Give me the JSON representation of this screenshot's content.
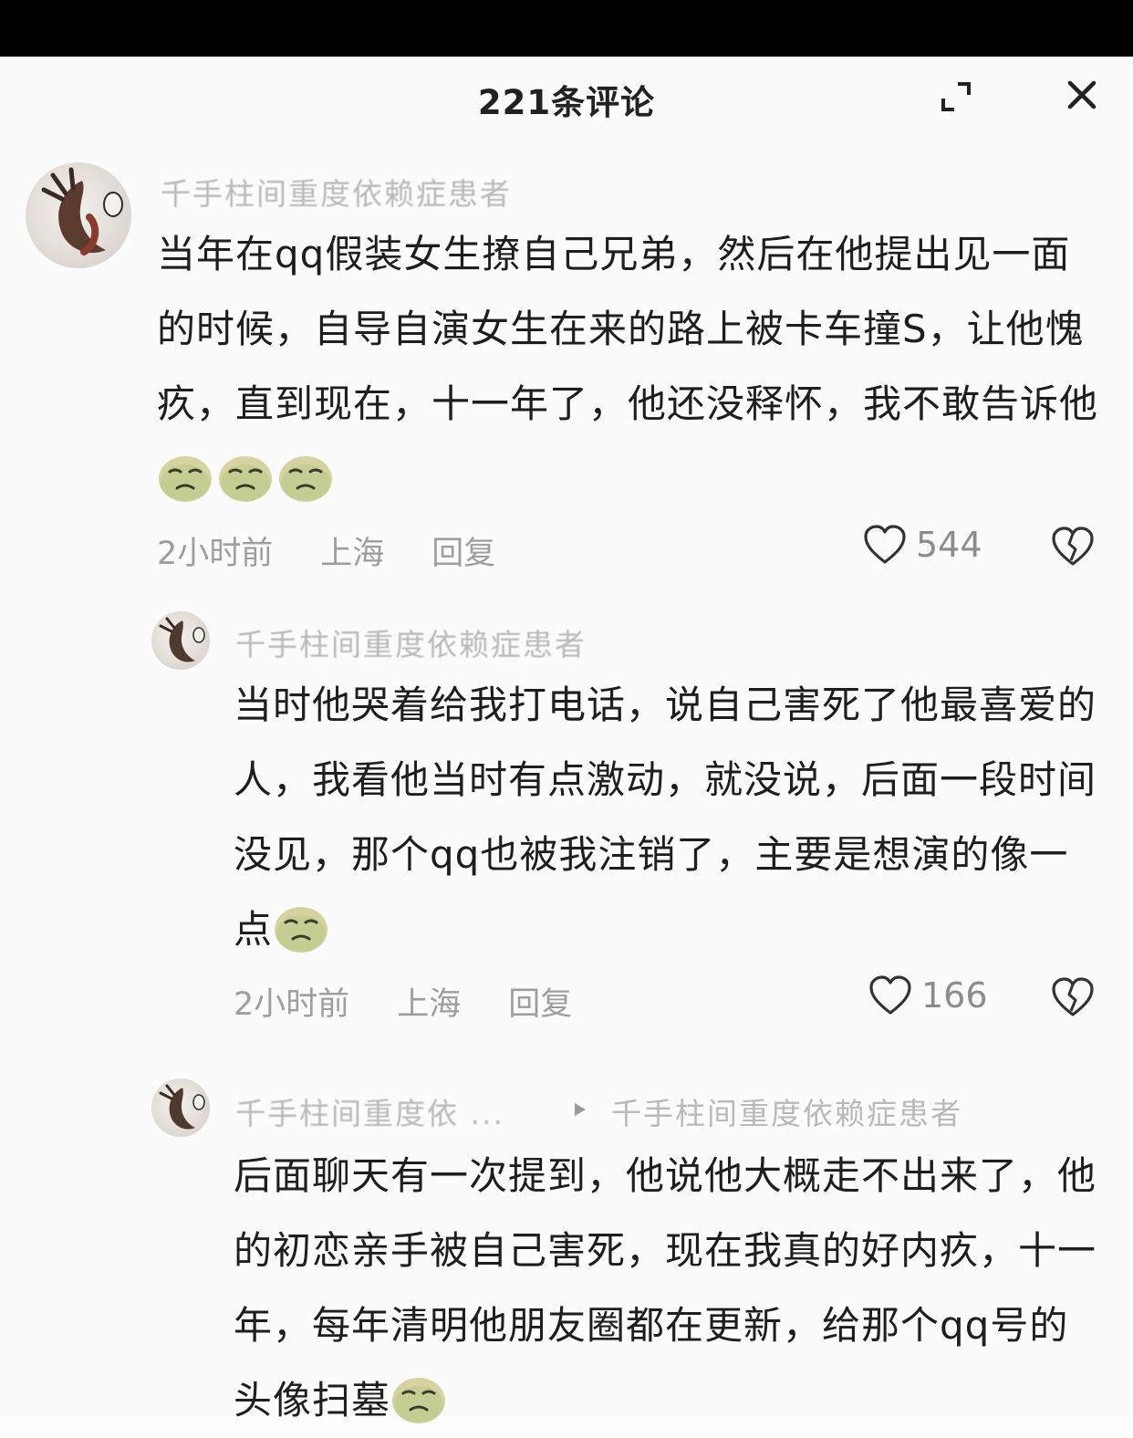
{
  "header": {
    "title": "221条评论",
    "expand_icon": "expand-icon",
    "close_icon": "close-icon"
  },
  "comments": [
    {
      "username": "千手柱间重度依赖症患者",
      "text": "当年在qq假装女生撩自己兄弟，然后在他提出见一面的时候，自导自演女生在来的路上被卡车撞S，让他愧疚，直到现在，十一年了，他还没释怀，我不敢告诉他",
      "emoji_count": 3,
      "time": "2小时前",
      "location": "上海",
      "reply_label": "回复",
      "likes": "544"
    },
    {
      "username": "千手柱间重度依赖症患者",
      "text": "当时他哭着给我打电话，说自己害死了他最喜爱的人，我看他当时有点激动，就没说，后面一段时间没见，那个qq也被我注销了，主要是想演的像一点",
      "emoji_count": 1,
      "time": "2小时前",
      "location": "上海",
      "reply_label": "回复",
      "likes": "166"
    },
    {
      "username": "千手柱间重度依 ...",
      "reply_to": "千手柱间重度依赖症患者",
      "text": "后面聊天有一次提到，他说他大概走不出来了，他的初恋亲手被自己害死，现在我真的好内疚，十一年，每年清明他朋友圈都在更新，给那个qq号的头像扫墓",
      "emoji_count": 1
    }
  ],
  "icons": {
    "like": "heart-icon",
    "dislike": "broken-heart-icon",
    "emoji": "crying-face-emoji",
    "reply_arrow": "reply-arrow-icon"
  }
}
